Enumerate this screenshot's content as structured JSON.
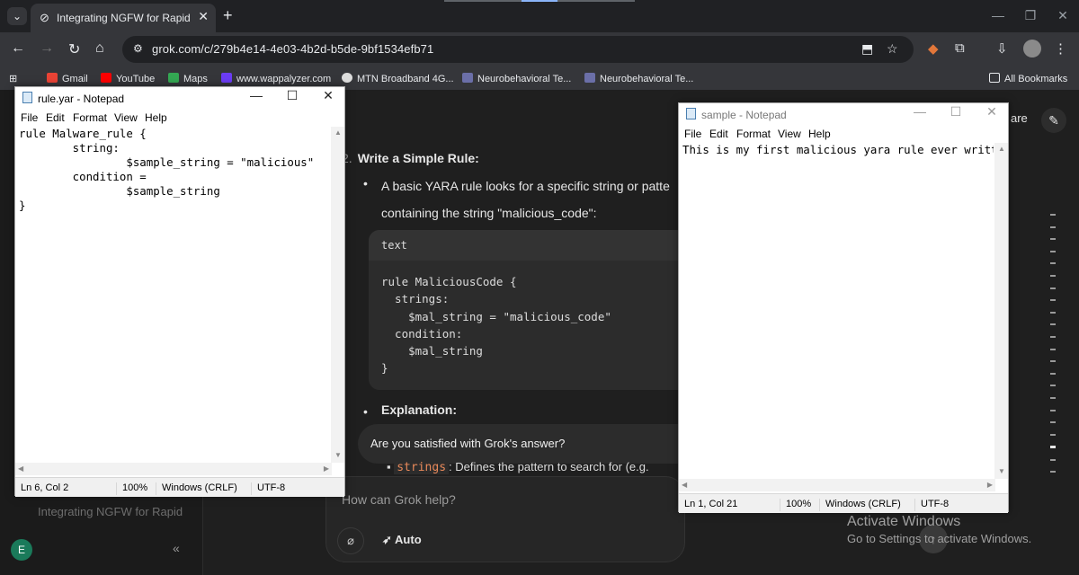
{
  "browser": {
    "tab_title": "Integrating NGFW for Rapid Th",
    "url": "grok.com/c/279b4e14-4e03-4b2d-b5de-9bf1534efb71",
    "bookmarks": [
      {
        "label": "Gmail",
        "color": "#ea4335"
      },
      {
        "label": "YouTube",
        "color": "#ff0000"
      },
      {
        "label": "Maps",
        "color": "#34a853"
      },
      {
        "label": "www.wappalyzer.com",
        "color": "#6b3cf4"
      },
      {
        "label": "MTN Broadband 4G...",
        "color": "#dddddd"
      },
      {
        "label": "Neurobehavioral Te...",
        "color": "#6b6fa8"
      },
      {
        "label": "Neurobehavioral Te...",
        "color": "#6b6fa8"
      }
    ],
    "all_bookmarks": "All Bookmarks"
  },
  "grok": {
    "header_share": "are",
    "step_number": "2.",
    "step_title": "Write a Simple Rule:",
    "bullet1_line1": "A basic YARA rule looks for a specific string or patte",
    "bullet1_line2": "containing the string \"malicious_code\":",
    "code_lang": "text",
    "code": "rule MaliciousCode {\n  strings:\n    $mal_string = \"malicious_code\"\n  condition:\n    $mal_string\n}",
    "explanation": "Explanation:",
    "satisfied": "Are you satisfied with Grok's answer?",
    "inline_code": "strings",
    "inline_rest": ": Defines the pattern to search for (e.g.",
    "placeholder": "How can Grok help?",
    "mode": "Auto",
    "sidebar_item": "Integrating NGFW for Rapid",
    "avatar_letter": "E"
  },
  "windows_notice": {
    "title": "Activate Windows",
    "subtitle": "Go to Settings to activate Windows."
  },
  "notepad_rule": {
    "title": "rule.yar - Notepad",
    "menu": [
      "File",
      "Edit",
      "Format",
      "View",
      "Help"
    ],
    "text": "rule Malware_rule {\n        string:\n                $sample_string = \"malicious\"\n        condition =\n                $sample_string\n}",
    "status": {
      "position": "Ln 6, Col 2",
      "zoom": "100%",
      "eol": "Windows (CRLF)",
      "encoding": "UTF-8"
    }
  },
  "notepad_sample": {
    "title": "sample - Notepad",
    "menu": [
      "File",
      "Edit",
      "Format",
      "View",
      "Help"
    ],
    "text": "This is my first malicious yara rule ever written",
    "status": {
      "position": "Ln 1, Col 21",
      "zoom": "100%",
      "eol": "Windows (CRLF)",
      "encoding": "UTF-8"
    }
  }
}
